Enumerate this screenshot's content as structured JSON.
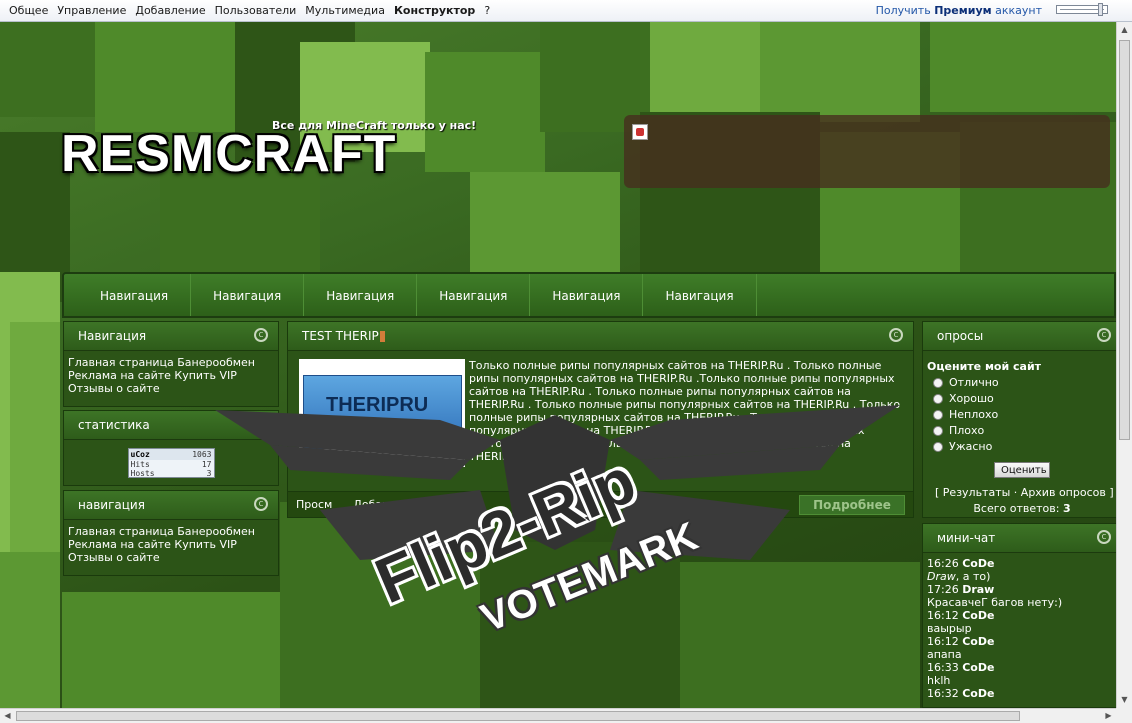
{
  "admin_bar": {
    "menu": [
      "Общее",
      "Управление",
      "Добавление",
      "Пользователи",
      "Мультимедиа",
      "Конструктор",
      "?"
    ],
    "premium_prefix": "Получить",
    "premium_bold": "Премиум",
    "premium_suffix": "аккаунт"
  },
  "header": {
    "logo": "RESMCRAFT",
    "slogan": "Все для MineCraft только у нас!"
  },
  "navbar": {
    "items": [
      "Навигация",
      "Навигация",
      "Навигация",
      "Навигация",
      "Навигация",
      "Навигация"
    ]
  },
  "left": {
    "nav1": {
      "title": "Навигация",
      "links": [
        "Главная страница",
        "Банерообмен",
        "Реклама на сайте",
        "Купить VIP",
        "Отзывы о сайте"
      ]
    },
    "stats": {
      "title": "статистика",
      "counter_brand": "uCoz",
      "counter_value": "1063",
      "hits_label": "Hits",
      "hits_value": "17",
      "hosts_label": "Hosts",
      "hosts_value": "3"
    },
    "nav2": {
      "title": "навигация",
      "links": [
        "Главная страница",
        "Банерообмен",
        "Реклама на сайте",
        "Купить VIP",
        "Отзывы о сайте"
      ]
    }
  },
  "center": {
    "title": "TEST THERIP",
    "thumb_text": "THERIPRU",
    "body": "Только полные рипы популярных сайтов на THERIP.Ru . Только полные рипы популярных сайтов на THERIP.Ru .Только полные рипы популярных сайтов на THERIP.Ru . Только полные рипы популярных сайтов на THERIP.Ru . Только полные рипы популярных сайтов на THERIP.Ru . Только полные рипы популярных сайтов на THERIP.Ru . Только полные рипы популярных сайтов на THERIP.Ru . Только полные рипы популярных сайтов на THERIP.Ru . Только полные рипы популярных сайтов на THERIP.Ru",
    "footer_views": "Просм",
    "footer_added": "Добав",
    "more": "Подробнее"
  },
  "poll": {
    "title": "опросы",
    "question": "Оцените мой сайт",
    "options": [
      "Отлично",
      "Хорошо",
      "Неплохо",
      "Плохо",
      "Ужасно"
    ],
    "vote": "Оценить",
    "results": "[ Результаты · Архив опросов ]",
    "total_label": "Всего ответов:",
    "total_value": "3"
  },
  "chat": {
    "title": "мини-чат",
    "messages": [
      {
        "time": "16:26",
        "user": "CoDe",
        "text_italic": "Draw",
        "text": ", а то)"
      },
      {
        "time": "17:26",
        "user": "Draw",
        "text_italic": "",
        "text": "КрасавчеГ багов нету:)"
      },
      {
        "time": "16:12",
        "user": "CoDe",
        "text_italic": "",
        "text": "ваырыр"
      },
      {
        "time": "16:12",
        "user": "CoDe",
        "text_italic": "",
        "text": "апапа"
      },
      {
        "time": "16:33",
        "user": "CoDe",
        "text_italic": "",
        "text": "hklh"
      },
      {
        "time": "16:32",
        "user": "CoDe",
        "text_italic": "",
        "text": ""
      }
    ]
  },
  "watermark": {
    "line1": "Flip2-Rip",
    "line2": "VOTEMARK"
  },
  "colors": {
    "nav_green": "#3f7d28",
    "block_green": "#2c5417",
    "premium_blue": "#2357a8"
  }
}
